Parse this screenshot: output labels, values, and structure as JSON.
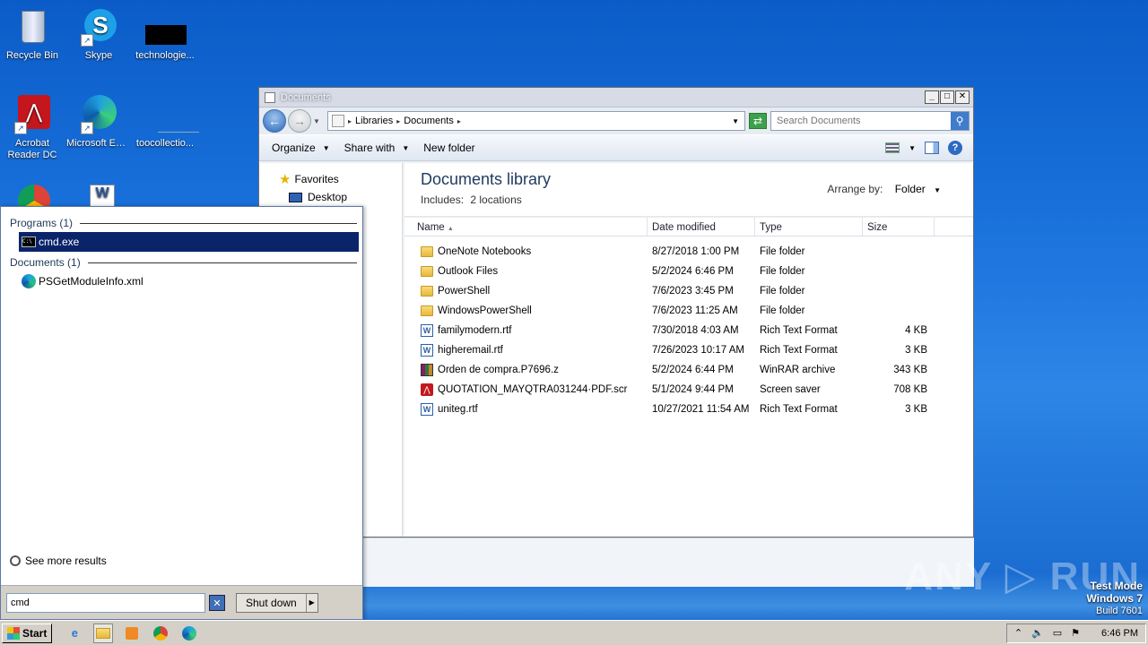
{
  "desktop": {
    "icons": [
      {
        "label": "Recycle Bin"
      },
      {
        "label": "Skype"
      },
      {
        "label": "technologie..."
      },
      {
        "label": "Acrobat Reader DC"
      },
      {
        "label": "Microsoft Edge"
      },
      {
        "label": "toocollectio..."
      }
    ],
    "test_mode": {
      "line1": "Test Mode",
      "line2": "Windows 7",
      "line3": "Build 7601"
    },
    "watermark": "ANY ▷ RUN"
  },
  "explorer": {
    "title": "Documents",
    "address": {
      "crumbs": [
        "Libraries",
        "Documents"
      ]
    },
    "search_placeholder": "Search Documents",
    "toolbar": {
      "organize": "Organize",
      "share_with": "Share with",
      "new_folder": "New folder"
    },
    "nav": {
      "favorites": "Favorites",
      "desktop": "Desktop"
    },
    "library": {
      "title": "Documents library",
      "includes_label": "Includes:",
      "includes_value": "2 locations",
      "arrange_label": "Arrange by:",
      "arrange_value": "Folder"
    },
    "columns": {
      "name": "Name",
      "date": "Date modified",
      "type": "Type",
      "size": "Size"
    },
    "files": [
      {
        "name": "OneNote Notebooks",
        "date": "8/27/2018 1:00 PM",
        "type": "File folder",
        "size": "",
        "icon": "folder"
      },
      {
        "name": "Outlook Files",
        "date": "5/2/2024 6:46 PM",
        "type": "File folder",
        "size": "",
        "icon": "folder"
      },
      {
        "name": "PowerShell",
        "date": "7/6/2023 3:45 PM",
        "type": "File folder",
        "size": "",
        "icon": "folder"
      },
      {
        "name": "WindowsPowerShell",
        "date": "7/6/2023 11:25 AM",
        "type": "File folder",
        "size": "",
        "icon": "folder"
      },
      {
        "name": "familymodern.rtf",
        "date": "7/30/2018 4:03 AM",
        "type": "Rich Text Format",
        "size": "4 KB",
        "icon": "rtf"
      },
      {
        "name": "higheremail.rtf",
        "date": "7/26/2023 10:17 AM",
        "type": "Rich Text Format",
        "size": "3 KB",
        "icon": "rtf"
      },
      {
        "name": "Orden de compra.P7696.z",
        "date": "5/2/2024 6:44 PM",
        "type": "WinRAR archive",
        "size": "343 KB",
        "icon": "rar"
      },
      {
        "name": "QUOTATION_MAYQTRA031244·PDF.scr",
        "date": "5/1/2024 9:44 PM",
        "type": "Screen saver",
        "size": "708 KB",
        "icon": "scr"
      },
      {
        "name": "uniteg.rtf",
        "date": "10/27/2021 11:54 AM",
        "type": "Rich Text Format",
        "size": "3 KB",
        "icon": "rtf"
      }
    ]
  },
  "start_menu": {
    "programs_header": "Programs (1)",
    "programs": [
      {
        "label": "cmd.exe"
      }
    ],
    "documents_header": "Documents (1)",
    "documents": [
      {
        "label": "PSGetModuleInfo.xml"
      }
    ],
    "see_more": "See more results",
    "search_value": "cmd",
    "shutdown_label": "Shut down"
  },
  "taskbar": {
    "start_label": "Start",
    "clock": "6:46 PM"
  }
}
